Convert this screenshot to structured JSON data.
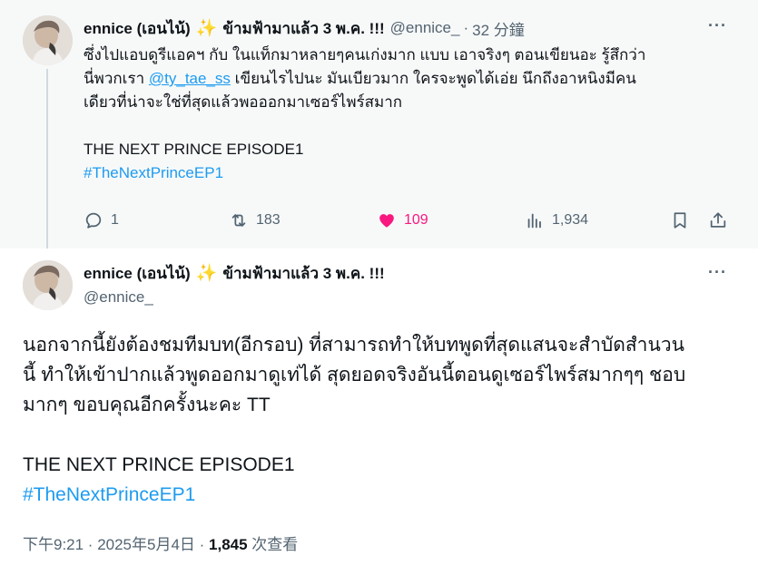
{
  "top_tweet": {
    "author_name": "ennice (เอนไน้)",
    "author_name_rest": "ข้ามฟ้ามาแล้ว 3 พ.ค. !!!",
    "sparkle": "✨",
    "handle": "@ennice_",
    "separator": "·",
    "time": "32 分鐘",
    "more": "···",
    "lines": [
      "ซึ่งไปแอบดูรีแอคฯ กับ ในแท็กมาหลายๆคนเก่งมาก แบบ เอาจริงๆ ตอนเขียนอะ รู้สึกว่า",
      "เขียนไรไปนะ มันเบียวมาก ใครจะพูดได้เอ่ย นึกถึงอาหนิงมีคน",
      "เดียวที่น่าจะใช่ที่สุดแล้วพอออกมาเซอร์ไพร์สมาก"
    ],
    "line2_prefix": "นี่พวกเรา",
    "mention": "@ty_tae_ss",
    "title_line": "THE NEXT PRINCE EPISODE1",
    "hashtag": "#TheNextPrinceEP1",
    "stats": {
      "replies": "1",
      "reposts": "183",
      "likes": "109",
      "views": "1,934"
    }
  },
  "main_tweet": {
    "author_name": "ennice (เอนไน้)",
    "author_name_rest": "ข้ามฟ้ามาแล้ว 3 พ.ค. !!!",
    "sparkle": "✨",
    "handle": "@ennice_",
    "more": "···",
    "lines": [
      "นอกจากนี้ยังต้องชมทีมบท(อีกรอบ) ที่สามารถทำให้บทพูดที่สุดแสนจะสำบัดสำนวน",
      "นี้ ทำให้เข้าปากแล้วพูดออกมาดูเท่ได้ สุดยอดจริงอันนี้ตอนดูเซอร์ไพร์สมากๆๆ ชอบ",
      "มากๆ ขอบคุณอีกครั้งนะคะ TT"
    ],
    "title_line": "THE NEXT PRINCE EPISODE1",
    "hashtag": "#TheNextPrinceEP1",
    "meta_time": "下午9:21 · 2025年5月4日 · ",
    "meta_views_count": "1,845",
    "meta_views_label": " 次查看"
  },
  "colors": {
    "accent": "#1d9bf0",
    "like": "#f91880",
    "muted": "#536471",
    "text": "#0f1419",
    "top_bg": "#f7f9f9"
  },
  "icons": [
    "reply-icon",
    "repost-icon",
    "like-icon",
    "views-icon",
    "bookmark-icon",
    "share-icon",
    "more-icon",
    "sparkle-icon"
  ]
}
